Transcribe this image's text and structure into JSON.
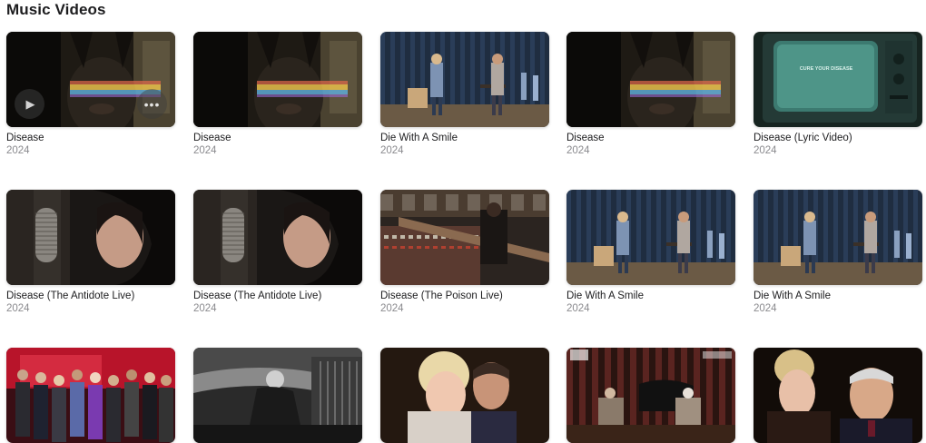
{
  "section": {
    "title": "Music Videos"
  },
  "videos": [
    {
      "title": "Disease",
      "year": "2024",
      "scene": "disease-light"
    },
    {
      "title": "Disease",
      "year": "2024",
      "scene": "disease-light"
    },
    {
      "title": "Die With A Smile",
      "year": "2024",
      "scene": "stage"
    },
    {
      "title": "Disease",
      "year": "2024",
      "scene": "disease-light"
    },
    {
      "title": "Disease (Lyric Video)",
      "year": "2024",
      "scene": "tv",
      "tv_text": "CURE YOUR DISEASE"
    },
    {
      "title": "Disease (The Antidote Live)",
      "year": "2024",
      "scene": "mic"
    },
    {
      "title": "Disease (The Antidote Live)",
      "year": "2024",
      "scene": "mic"
    },
    {
      "title": "Disease (The Poison Live)",
      "year": "2024",
      "scene": "studio"
    },
    {
      "title": "Die With A Smile",
      "year": "2024",
      "scene": "stage"
    },
    {
      "title": "Die With A Smile",
      "year": "2024",
      "scene": "stage"
    },
    {
      "title": "",
      "year": "",
      "scene": "group"
    },
    {
      "title": "",
      "year": "",
      "scene": "bw"
    },
    {
      "title": "",
      "year": "",
      "scene": "duet-warm"
    },
    {
      "title": "",
      "year": "",
      "scene": "piano-room"
    },
    {
      "title": "",
      "year": "",
      "scene": "duet-dark"
    }
  ],
  "hover_controls": {
    "play_icon": "play-icon",
    "more_icon": "ellipsis-icon"
  }
}
